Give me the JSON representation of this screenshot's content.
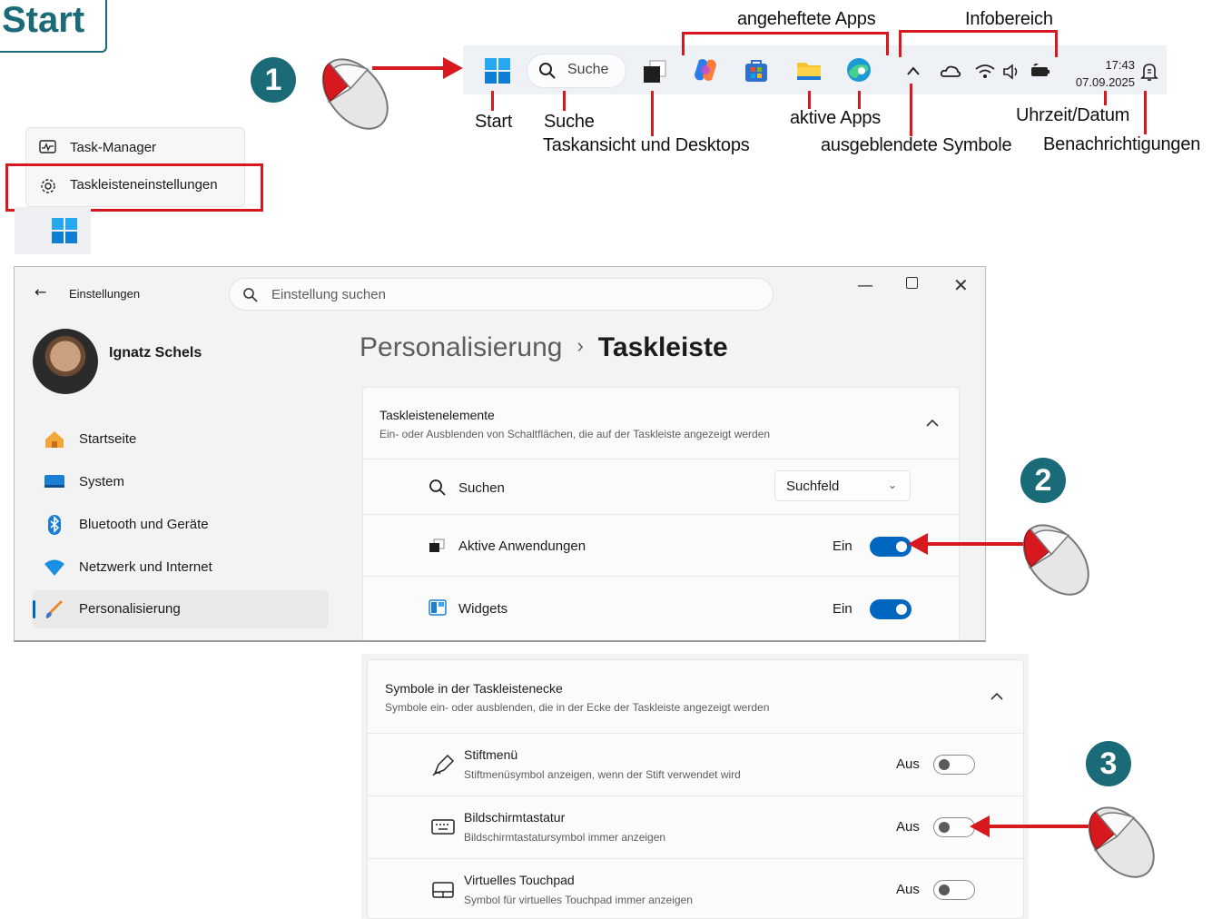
{
  "corner_label": "Start",
  "badges": [
    "1",
    "2",
    "3"
  ],
  "taskbar": {
    "search_label": "Suche",
    "time": "17:43",
    "date": "07.09.2025",
    "icons": [
      "windows-start-icon",
      "search-icon",
      "task-view-icon",
      "copilot-icon",
      "store-icon",
      "file-explorer-icon",
      "edge-icon",
      "chevron-up-icon",
      "onedrive-icon",
      "wifi-icon",
      "speaker-icon",
      "battery-icon",
      "notification-bell-icon"
    ]
  },
  "callouts": {
    "pinned_apps": "angeheftete Apps",
    "info_area": "Infobereich",
    "start": "Start",
    "search": "Suche",
    "task_view": "Taskansicht und Desktops",
    "active_apps": "aktive Apps",
    "hidden_icons": "ausgeblendete Symbole",
    "time_date": "Uhrzeit/Datum",
    "notifications": "Benachrichtigungen"
  },
  "context_menu": {
    "items": [
      {
        "label": "Task-Manager",
        "icon": "task-manager-icon"
      },
      {
        "label": "Taskleisteneinstellungen",
        "icon": "gear-icon"
      }
    ]
  },
  "settings": {
    "app_title": "Einstellungen",
    "search_placeholder": "Einstellung suchen",
    "user_name": "Ignatz Schels",
    "nav": [
      {
        "label": "Startseite",
        "icon": "home-icon"
      },
      {
        "label": "System",
        "icon": "monitor-icon"
      },
      {
        "label": "Bluetooth und Geräte",
        "icon": "bluetooth-icon"
      },
      {
        "label": "Netzwerk und Internet",
        "icon": "network-icon"
      },
      {
        "label": "Personalisierung",
        "icon": "brush-icon",
        "selected": true
      }
    ],
    "breadcrumb": {
      "parent": "Personalisierung",
      "separator": "›",
      "current": "Taskleiste"
    },
    "section1": {
      "title": "Taskleistenelemente",
      "subtitle": "Ein- oder Ausblenden von Schaltflächen, die auf der Taskleiste angezeigt werden",
      "rows": [
        {
          "label": "Suchen",
          "control": "dropdown",
          "value": "Suchfeld"
        },
        {
          "label": "Aktive Anwendungen",
          "state": "Ein",
          "on": true
        },
        {
          "label": "Widgets",
          "state": "Ein",
          "on": true
        }
      ]
    },
    "section2": {
      "title": "Symbole in der Taskleistenecke",
      "subtitle": "Symbole ein- oder ausblenden, die in der Ecke der Taskleiste angezeigt werden",
      "rows": [
        {
          "label": "Stiftmenü",
          "sub": "Stiftmenüsymbol anzeigen, wenn der Stift verwendet wird",
          "state": "Aus",
          "on": false
        },
        {
          "label": "Bildschirmtastatur",
          "sub": "Bildschirmtastatursymbol immer anzeigen",
          "state": "Aus",
          "on": false
        },
        {
          "label": "Virtuelles Touchpad",
          "sub": "Symbol für virtuelles Touchpad immer anzeigen",
          "state": "Aus",
          "on": false
        }
      ]
    }
  },
  "colors": {
    "accent": "#0067c0",
    "highlight_red": "#d7191f",
    "badge_teal": "#1a6a78"
  }
}
